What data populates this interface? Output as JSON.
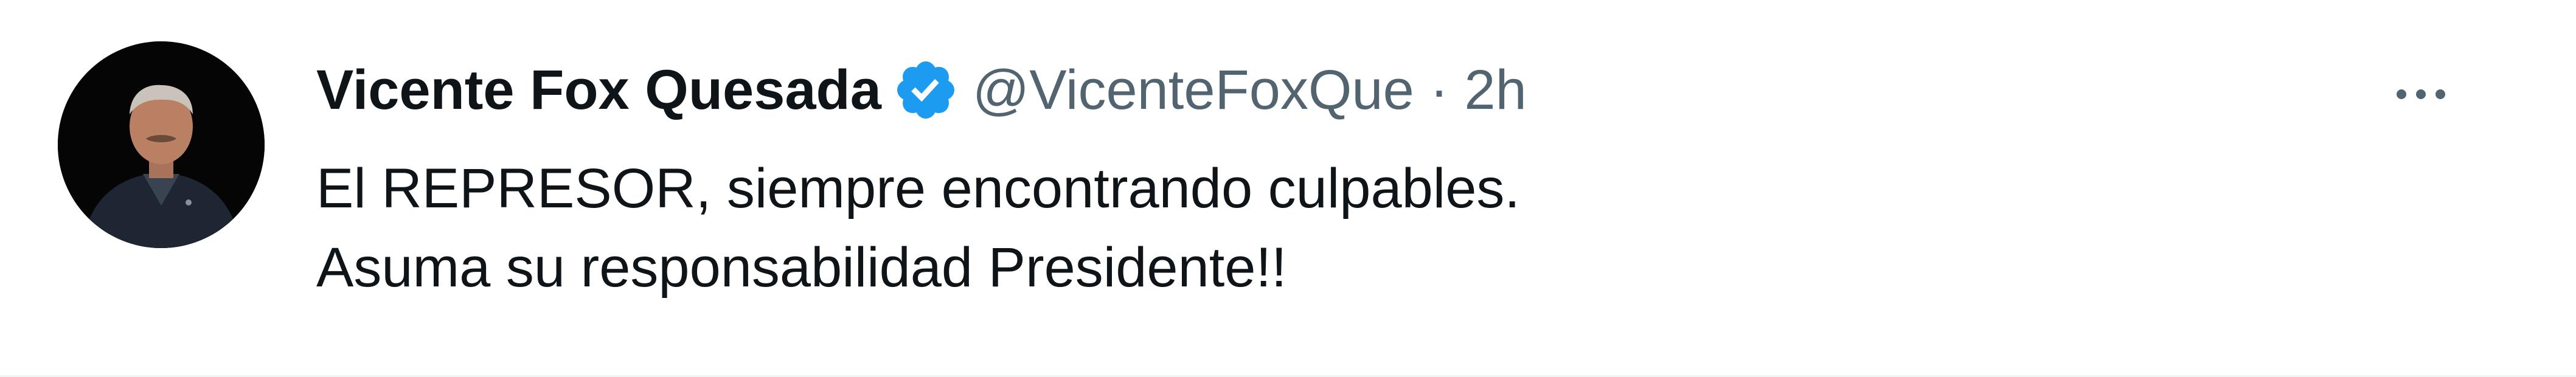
{
  "tweet": {
    "author": {
      "display_name": "Vicente Fox Quesada",
      "handle": "@VicenteFoxQue",
      "verified": true,
      "avatar_icon": "profile-photo"
    },
    "separator": "·",
    "timestamp": "2h",
    "text_lines": [
      "El REPRESOR, siempre encontrando culpables.",
      "Asuma su responsabilidad Presidente!!"
    ],
    "more_icon": "ellipsis-icon"
  },
  "colors": {
    "primary_text": "#0f1419",
    "secondary_text": "#536471",
    "verified_blue": "#1d9bf0",
    "background": "#ffffff"
  }
}
